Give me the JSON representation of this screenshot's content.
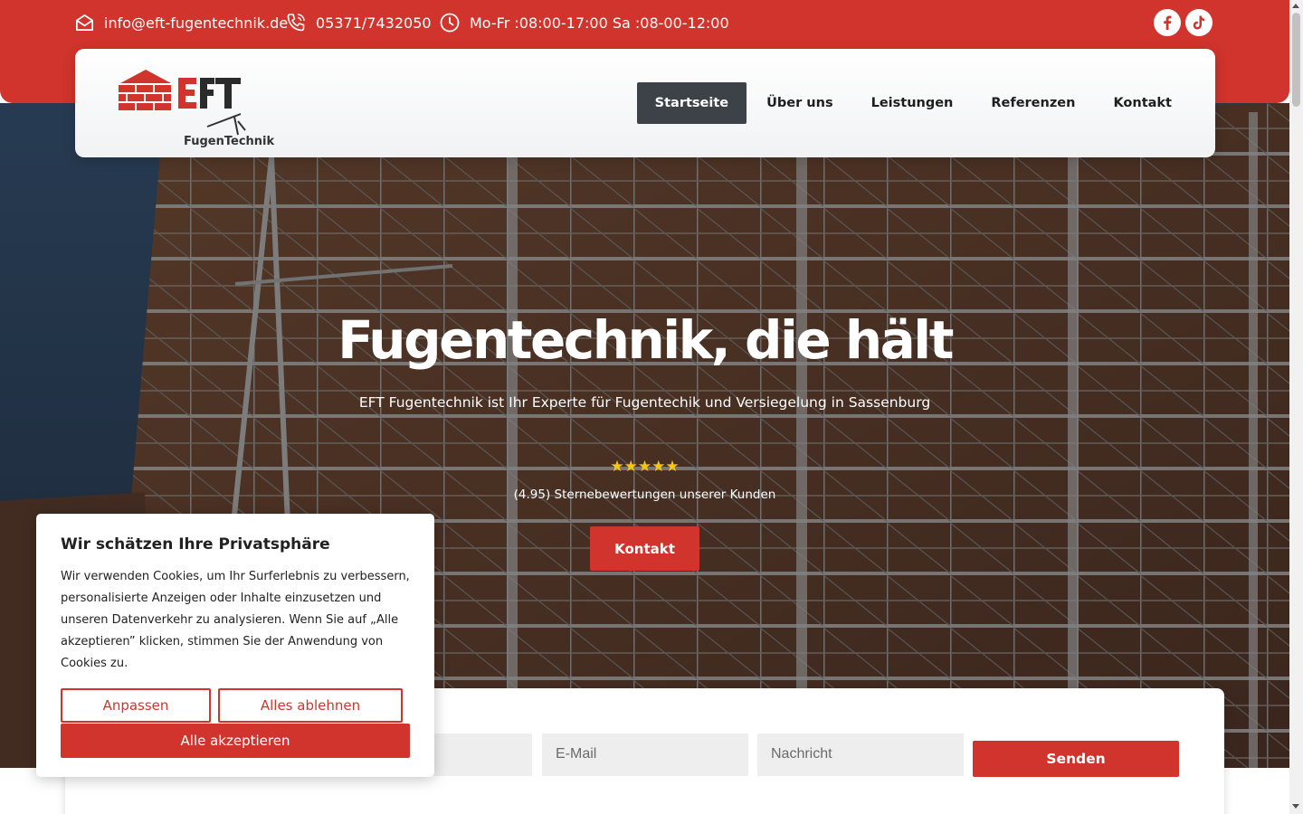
{
  "topbar": {
    "email": "info@eft-fugentechnik.de",
    "phone": "05371/7432050",
    "hours": "Mo-Fr :08:00-17:00 Sa :08-00-12:00",
    "social": [
      "facebook-icon",
      "tiktok-icon"
    ]
  },
  "logo": {
    "letters": "EFT",
    "tagline": "FugenTechnik"
  },
  "nav": {
    "items": [
      {
        "label": "Startseite",
        "active": true
      },
      {
        "label": "Über uns"
      },
      {
        "label": "Leistungen"
      },
      {
        "label": "Referenzen"
      },
      {
        "label": "Kontakt"
      }
    ]
  },
  "hero": {
    "title": "Fugentechnik, die hält",
    "subtitle": "EFT Fugentechnik ist Ihr Experte für Fugentechik und Versiegelung in Sassenburg",
    "stars": "★★★★★",
    "rating_text": "(4.95) Sternebewertungen unserer Kunden",
    "button": "Kontakt"
  },
  "form": {
    "email_placeholder": "E-Mail",
    "message_placeholder": "Nachricht",
    "submit": "Senden"
  },
  "cookie": {
    "title": "Wir schätzen Ihre Privatsphäre",
    "text": "Wir verwenden Cookies, um Ihr Surferlebnis zu verbessern, personalisierte Anzeigen oder Inhalte einzusetzen und unseren Datenverkehr zu analysieren. Wenn Sie auf „Alle akzeptieren” klicken, stimmen Sie der Anwendung von Cookies zu.",
    "customize": "Anpassen",
    "reject": "Alles ablehnen",
    "accept": "Alle akzeptieren"
  },
  "colors": {
    "brand_red": "#d0342c",
    "nav_active": "#3d4248",
    "star": "#f5c518"
  }
}
